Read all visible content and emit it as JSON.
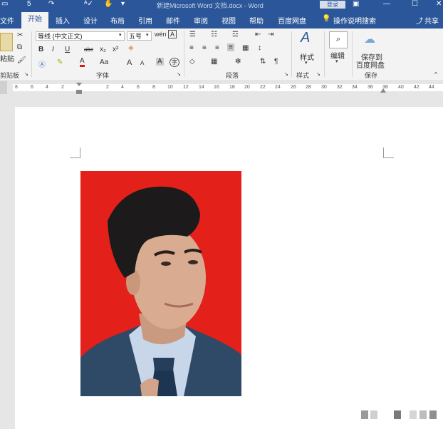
{
  "titlebar": {
    "title": "新建Microsoft Word 文档.docx - Word",
    "login": "登录",
    "qa_undo": "5",
    "qa_redo": "↷",
    "qa_more": "▾"
  },
  "tabs": {
    "file": "文件",
    "home": "开始",
    "insert": "插入",
    "design": "设计",
    "layout": "布局",
    "references": "引用",
    "mailings": "邮件",
    "review": "审阅",
    "view": "视图",
    "help": "帮助",
    "baidu": "百度网盘",
    "tellme": "操作说明搜索",
    "share": "共享"
  },
  "ribbon": {
    "clipboard_paste": "粘贴",
    "clipboard_label": "剪贴板",
    "font_name": "等线 (中文正文)",
    "font_size": "五号",
    "font_label": "字体",
    "paragraph_label": "段落",
    "styles_btn": "样式",
    "styles_label": "样式",
    "editing_btn": "编辑",
    "save_baidu_1": "保存到",
    "save_baidu_2": "百度网盘",
    "save_label": "保存",
    "bold": "B",
    "italic": "I",
    "underline": "U",
    "strike": "abc",
    "sub": "x₂",
    "sup": "x²",
    "font_color": "A",
    "aa": "Aa",
    "grow": "A",
    "shrink": "A",
    "char_border": "A",
    "wen": "wén"
  },
  "ruler": {
    "ticks": [
      "8",
      "6",
      "4",
      "2",
      "2",
      "4",
      "6",
      "8",
      "10",
      "12",
      "14",
      "16",
      "18",
      "20",
      "22",
      "24",
      "26",
      "28",
      "30",
      "32",
      "34",
      "36",
      "38",
      "40",
      "42",
      "44",
      "46"
    ]
  },
  "colors": {
    "brand": "#2b579a",
    "photo_bg": "#e3201a",
    "suit": "#2f4a66",
    "shirt": "#c8d6ea",
    "tie": "#1d3550"
  }
}
